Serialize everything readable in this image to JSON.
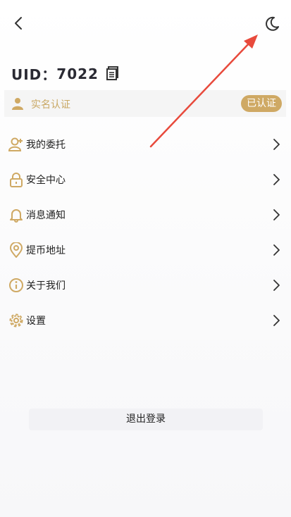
{
  "header": {
    "back_icon": "chevron-left-icon",
    "theme_icon": "moon-icon"
  },
  "profile": {
    "uid_label": "UID：",
    "uid_value": "7022",
    "copy_icon": "copy-icon"
  },
  "verification": {
    "label": "实名认证",
    "status": "已认证",
    "icon": "user-icon"
  },
  "menu": {
    "items": [
      {
        "label": "我的委托",
        "icon": "user-plus-icon"
      },
      {
        "label": "安全中心",
        "icon": "lock-icon"
      },
      {
        "label": "消息通知",
        "icon": "bell-icon"
      },
      {
        "label": "提币地址",
        "icon": "location-pin-icon"
      },
      {
        "label": "关于我们",
        "icon": "info-icon"
      },
      {
        "label": "设置",
        "icon": "gear-icon"
      }
    ]
  },
  "logout": {
    "label": "退出登录"
  },
  "colors": {
    "accent": "#cfa964",
    "annotation_arrow": "#e84a3c"
  }
}
